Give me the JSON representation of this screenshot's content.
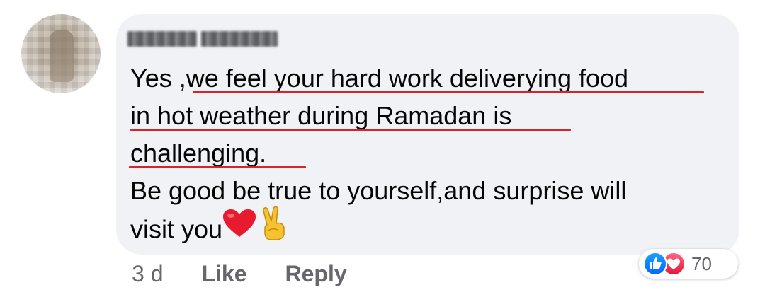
{
  "comment": {
    "author_name": "Sajid Jamila",
    "lines": [
      "Yes ,we feel your hard work deliverying food",
      "in hot weather during Ramadan is",
      "challenging. ",
      "Be good be true to yourself,and surprise will",
      "visit you"
    ],
    "emojis": [
      "red-heart",
      "victory-hand"
    ],
    "annotation_color": "#d8232a",
    "bubble_color": "#f0f2f5"
  },
  "meta": {
    "time": "3 d",
    "like_label": "Like",
    "reply_label": "Reply"
  },
  "reactions": {
    "icons": [
      "like-reaction-icon",
      "love-reaction-icon"
    ],
    "count": "70",
    "like_color": "#0866ff",
    "love_color": "#e61739"
  }
}
